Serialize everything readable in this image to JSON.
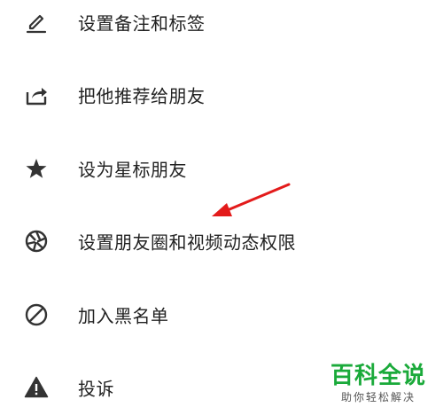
{
  "menu": {
    "items": [
      {
        "label": "设置备注和标签",
        "icon": "edit-pencil-icon"
      },
      {
        "label": "把他推荐给朋友",
        "icon": "share-icon"
      },
      {
        "label": "设为星标朋友",
        "icon": "star-icon"
      },
      {
        "label": "设置朋友圈和视频动态权限",
        "icon": "aperture-icon"
      },
      {
        "label": "加入黑名单",
        "icon": "block-icon"
      },
      {
        "label": "投诉",
        "icon": "warning-icon"
      }
    ],
    "icon_color": "#333333",
    "text_color": "#222222"
  },
  "annotation": {
    "arrow_color": "#e31b1b"
  },
  "watermark": {
    "title": "百科全说",
    "subtitle": "助你轻松解决",
    "title_color": "#1aaa3a"
  }
}
